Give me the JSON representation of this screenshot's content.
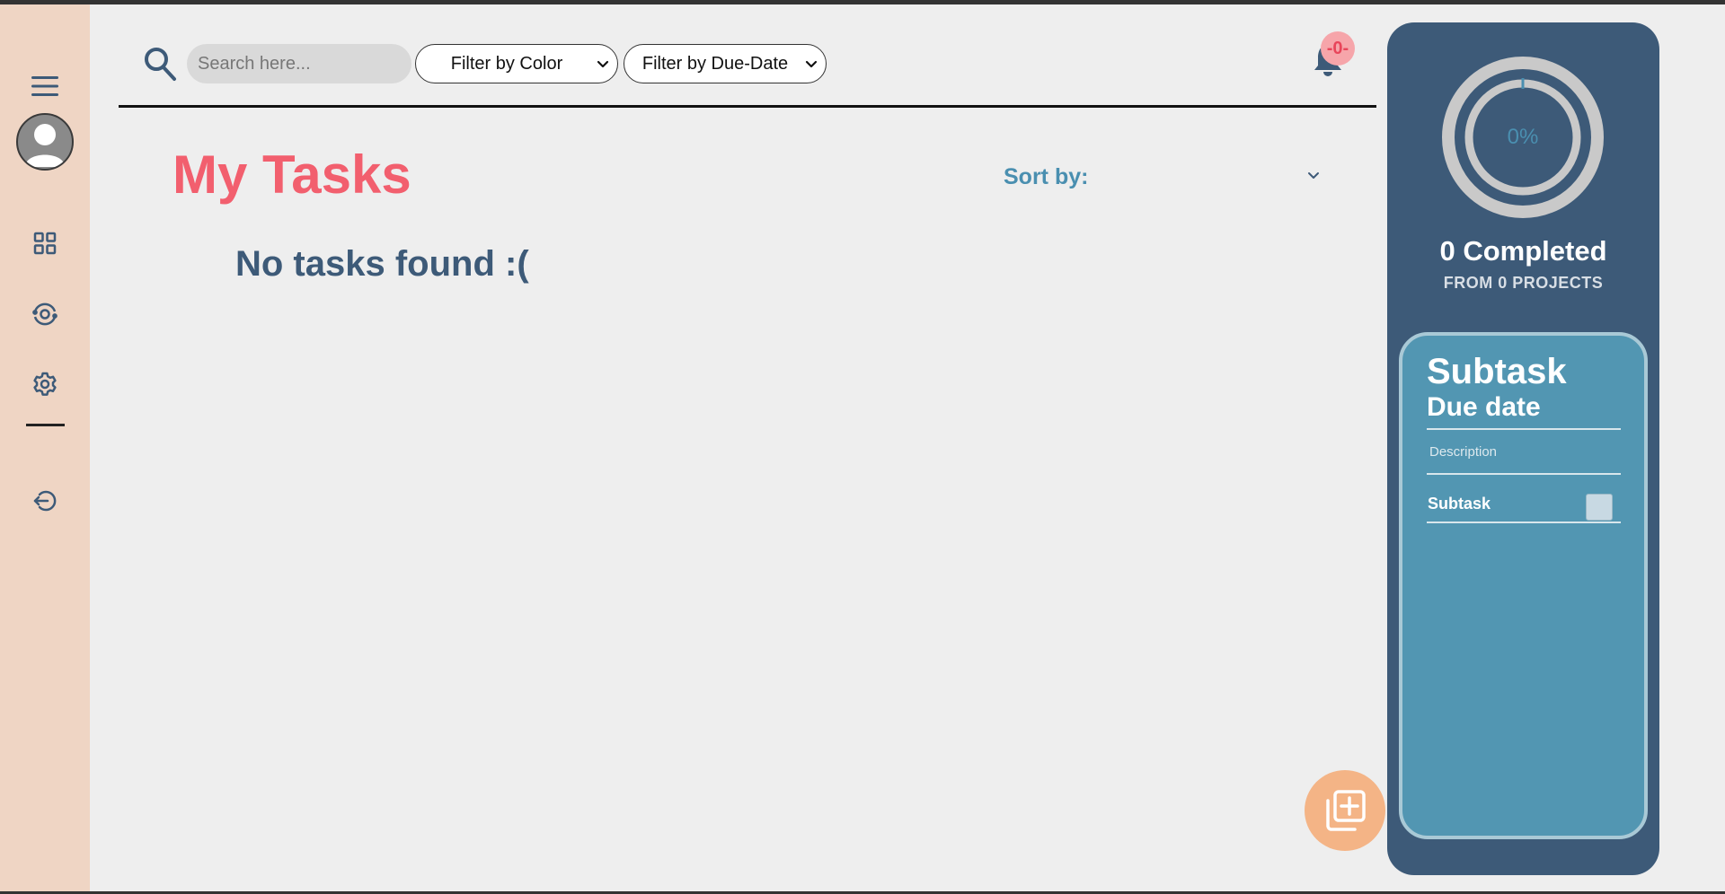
{
  "colors": {
    "sidebar_bg": "#efd5c4",
    "accent_red": "#f25f6e",
    "panel_navy": "#3d5a78",
    "card_blue": "#5296b2",
    "fab_orange": "#f4b486",
    "sort_blue": "#4a8fb0"
  },
  "sidebar": {
    "items": [
      {
        "icon": "menu-icon"
      },
      {
        "icon": "avatar-icon"
      },
      {
        "icon": "dashboard-grid-icon"
      },
      {
        "icon": "progress-icon"
      },
      {
        "icon": "settings-gear-icon"
      },
      {
        "icon": "logout-icon"
      }
    ]
  },
  "header": {
    "search_placeholder": "Search here...",
    "filter_color": {
      "selected": "Filter by Color"
    },
    "filter_due": {
      "selected": "Filter by Due-Date"
    },
    "notifications_badge": "-0-"
  },
  "main": {
    "title": "My Tasks",
    "sort_label": "Sort by:",
    "empty_message": "No tasks found :("
  },
  "stats": {
    "progress_percent": 0,
    "progress_label": "0%",
    "completed": "0 Completed",
    "from_projects": "FROM 0 PROJECTS"
  },
  "task_card": {
    "title": "Subtask",
    "due": "Due date",
    "description": "Description",
    "subtask_label": "Subtask",
    "subtask_checked": false
  }
}
